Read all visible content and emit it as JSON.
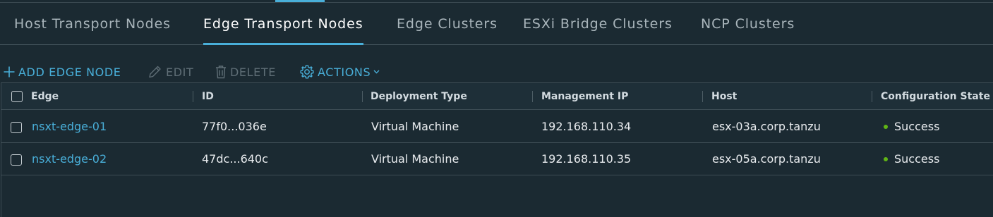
{
  "tabs": [
    {
      "label": "Host Transport Nodes"
    },
    {
      "label": "Edge Transport Nodes"
    },
    {
      "label": "Edge Clusters"
    },
    {
      "label": "ESXi Bridge Clusters"
    },
    {
      "label": "NCP Clusters"
    }
  ],
  "active_tab": "Edge Transport Nodes",
  "toolbar": {
    "add_label": "ADD EDGE NODE",
    "edit_label": "EDIT",
    "delete_label": "DELETE",
    "actions_label": "ACTIONS"
  },
  "table": {
    "columns": [
      "Edge",
      "ID",
      "Deployment Type",
      "Management IP",
      "Host",
      "Configuration State"
    ],
    "rows": [
      {
        "edge": "nsxt-edge-01",
        "id": "77f0...036e",
        "deployment_type": "Virtual Machine",
        "management_ip": "192.168.110.34",
        "host": "esx-03a.corp.tanzu",
        "state": "Success"
      },
      {
        "edge": "nsxt-edge-02",
        "id": "47dc...640c",
        "deployment_type": "Virtual Machine",
        "management_ip": "192.168.110.35",
        "host": "esx-05a.corp.tanzu",
        "state": "Success"
      }
    ]
  },
  "colors": {
    "background": "#1b2a32",
    "accent": "#49afd9",
    "success": "#60b515",
    "disabled": "#5f6e76"
  }
}
